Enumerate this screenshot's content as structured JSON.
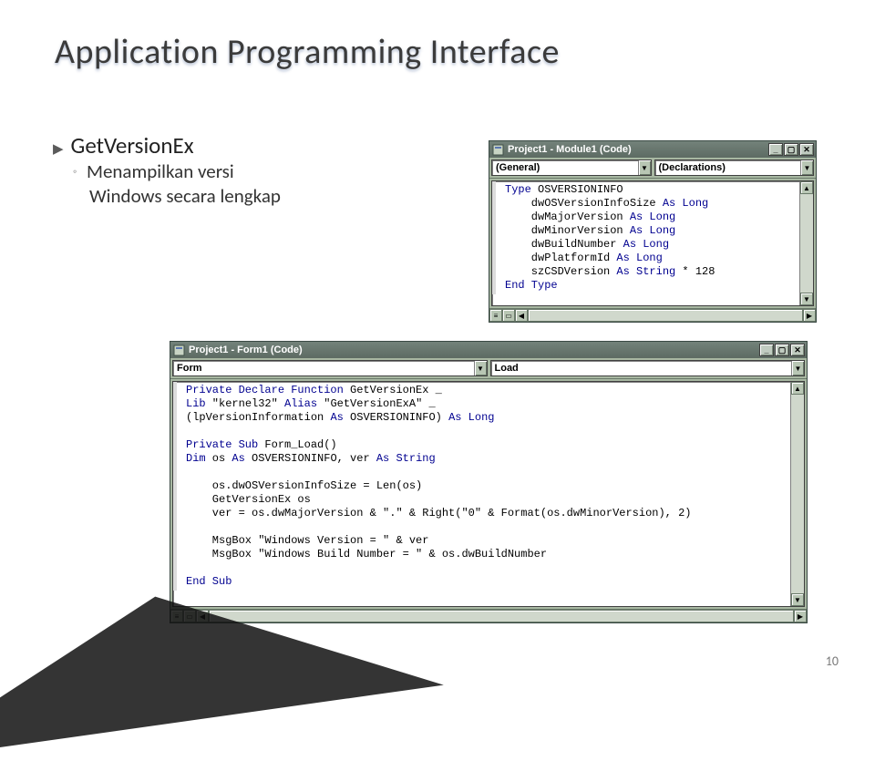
{
  "title": "Application Programming Interface",
  "bullets": {
    "b1": "GetVersionEx",
    "b2a": "Menampilkan versi",
    "b2b": "Windows secara lengkap"
  },
  "win1": {
    "title": "Project1 - Module1 (Code)",
    "combo_left": "(General)",
    "combo_right": "(Declarations)",
    "code_html": "<span class=\"kw\">Type</span> OSVERSIONINFO\n    dwOSVersionInfoSize <span class=\"kw\">As Long</span>\n    dwMajorVersion <span class=\"kw\">As Long</span>\n    dwMinorVersion <span class=\"kw\">As Long</span>\n    dwBuildNumber <span class=\"kw\">As Long</span>\n    dwPlatformId <span class=\"kw\">As Long</span>\n    szCSDVersion <span class=\"kw\">As String</span> * 128\n<span class=\"kw\">End Type</span>"
  },
  "win2": {
    "title": "Project1 - Form1 (Code)",
    "combo_left": "Form",
    "combo_right": "Load",
    "code_html": "<span class=\"kw\">Private Declare Function</span> GetVersionEx _\n<span class=\"kw\">Lib</span> \"kernel32\" <span class=\"kw\">Alias</span> \"GetVersionExA\" _\n(lpVersionInformation <span class=\"kw\">As</span> OSVERSIONINFO) <span class=\"kw\">As Long</span>\n\n<span class=\"kw\">Private Sub</span> Form_Load()\n<span class=\"kw\">Dim</span> os <span class=\"kw\">As</span> OSVERSIONINFO, ver <span class=\"kw\">As String</span>\n\n    os.dwOSVersionInfoSize = Len(os)\n    GetVersionEx os\n    ver = os.dwMajorVersion &amp; \".\" &amp; Right(\"0\" &amp; Format(os.dwMinorVersion), 2)\n\n    MsgBox \"Windows Version = \" &amp; ver\n    MsgBox \"Windows Build Number = \" &amp; os.dwBuildNumber\n\n<span class=\"kw\">End Sub</span>"
  },
  "page_number": "10"
}
